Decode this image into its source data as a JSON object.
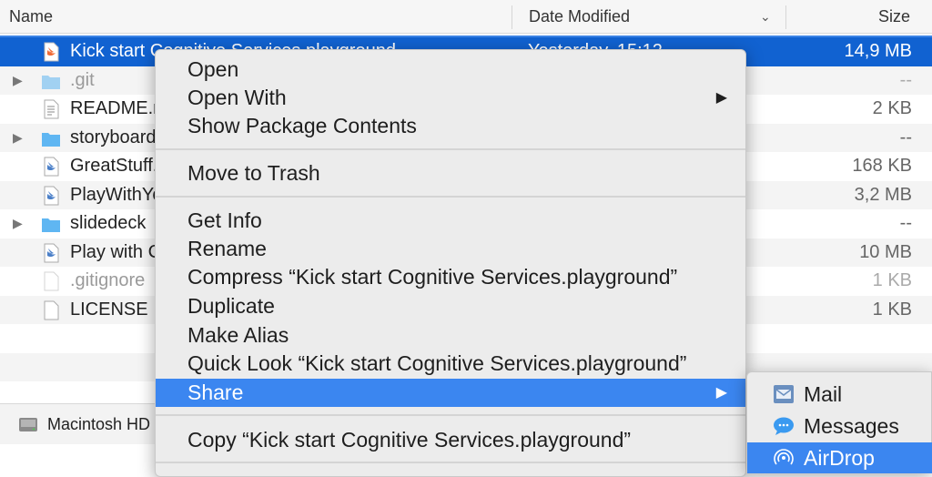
{
  "header": {
    "name": "Name",
    "date_modified": "Date Modified",
    "size": "Size"
  },
  "files": [
    {
      "name": "Kick start Cognitive Services.playground",
      "date": "Yesterday, 15:12",
      "size": "14,9 MB",
      "icon": "swift-file-icon",
      "expandable": false
    },
    {
      "name": ".git",
      "date": "",
      "size": "--",
      "icon": "folder-icon",
      "expandable": true
    },
    {
      "name": "README.md",
      "date": "",
      "size": "2 KB",
      "icon": "text-file-icon",
      "expandable": false
    },
    {
      "name": "storyboards",
      "date": "",
      "size": "--",
      "icon": "folder-icon",
      "expandable": true
    },
    {
      "name": "GreatStuff.playground",
      "date": "",
      "size": "168 KB",
      "icon": "swift-file-icon",
      "expandable": false
    },
    {
      "name": "PlayWithYourVoice.playground",
      "date": "",
      "size": "3,2 MB",
      "icon": "swift-file-icon",
      "expandable": false
    },
    {
      "name": "slidedeck",
      "date": "",
      "size": "--",
      "icon": "folder-icon",
      "expandable": true
    },
    {
      "name": "Play with Cognitive Services.playground",
      "date": "",
      "size": "10 MB",
      "icon": "swift-file-icon",
      "expandable": false
    },
    {
      "name": ".gitignore",
      "date": "",
      "size": "1 KB",
      "icon": "blank-file-icon",
      "expandable": false
    },
    {
      "name": "LICENSE",
      "date": "",
      "size": "1 KB",
      "icon": "blank-file-icon",
      "expandable": false
    }
  ],
  "path_bar": {
    "disk": "Macintosh HD"
  },
  "menu": {
    "open": "Open",
    "open_with": "Open With",
    "show_package_contents": "Show Package Contents",
    "move_to_trash": "Move to Trash",
    "get_info": "Get Info",
    "rename": "Rename",
    "compress": "Compress “Kick start Cognitive Services.playground”",
    "duplicate": "Duplicate",
    "make_alias": "Make Alias",
    "quick_look": "Quick Look “Kick start Cognitive Services.playground”",
    "share": "Share",
    "copy": "Copy “Kick start Cognitive Services.playground”"
  },
  "share_menu": {
    "mail": "Mail",
    "messages": "Messages",
    "airdrop": "AirDrop"
  },
  "colors": {
    "selection": "#1162d1",
    "menu_highlight": "#3b86f0",
    "folder": "#5fb6f2"
  }
}
